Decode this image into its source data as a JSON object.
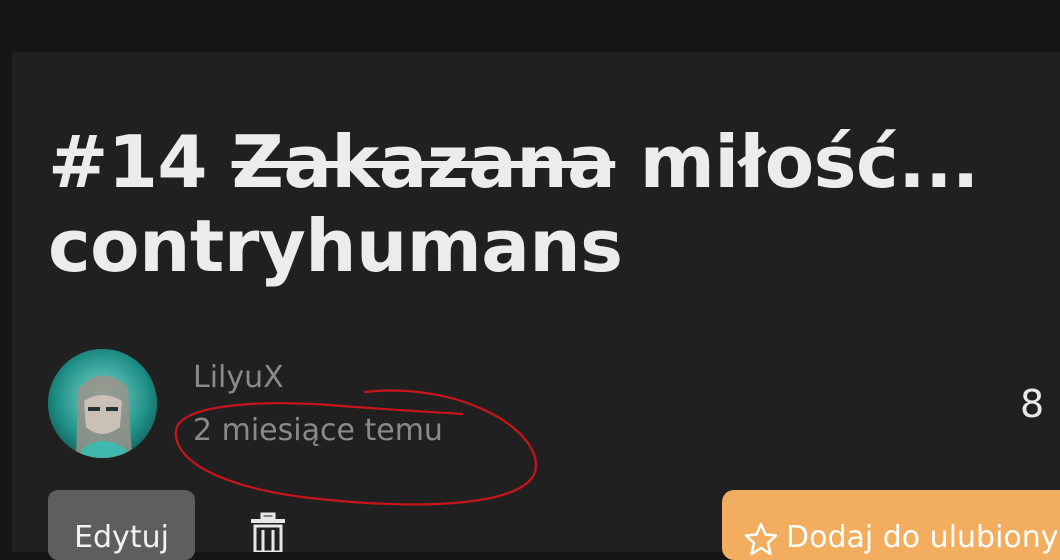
{
  "story": {
    "number": "#14",
    "struck_word": "Zakazana",
    "title_rest": "miłość...",
    "title_line2": "contryhumans"
  },
  "author": {
    "name": "LilyuX",
    "time_ago": "2 miesiące temu",
    "avatar_icon": "avatar-image"
  },
  "stats": {
    "value": "8"
  },
  "actions": {
    "edit_label": "Edytuj",
    "delete_icon": "trash-icon",
    "favorite_label": "Dodaj do ulubionych",
    "favorite_icon": "star-icon"
  },
  "colors": {
    "background": "#151515",
    "card": "#202020",
    "favorite_button": "#f2ad5e",
    "annotation": "#c8141a"
  }
}
